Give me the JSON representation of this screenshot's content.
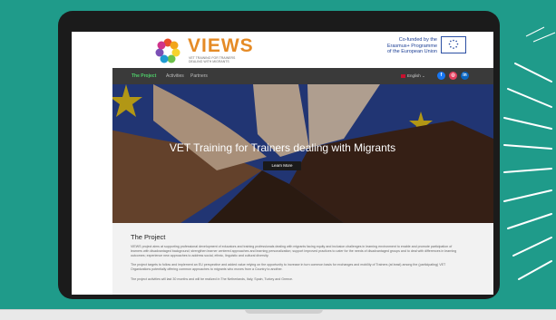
{
  "logo": {
    "name": "VIEWS",
    "tagline": "VET TRAINING FOR TRAINERS DEALING WITH MIGRANTS"
  },
  "cofund": {
    "line1": "Co-funded by the",
    "line2": "Erasmus+ Programme",
    "line3": "of the European Union"
  },
  "nav": {
    "items": [
      {
        "label": "The Project"
      },
      {
        "label": "Activities"
      },
      {
        "label": "Partners"
      }
    ],
    "language": "English",
    "social": {
      "facebook": "f",
      "instagram": "◎",
      "linkedin": "in"
    }
  },
  "hero": {
    "title": "VET Training for Trainers dealing with Migrants",
    "button_label": "Learn More"
  },
  "project": {
    "heading": "The Project",
    "para1": "VIEWS project aims at supporting professional development of educators and training professionals dealing with migrants facing equity and inclusion challenges in learning environment to enable and promote participation of learners with disadvantaged background; strengthen learner centered approaches and learning personalization; support improved practices to cater for the needs of disadvantaged groups and to deal with differences in learning outcomes; experience new approaches to address social, ethnic, linguistic and cultural diversity.",
    "para2": "The project targets to follow and implement an EU perspective and added value relying on the opportunity to increase in turn common basis for exchanges and mobility of Trainers (at least) among the (participating) VET Organizations potentially offering common approaches to migrants who moves from a Country to another.",
    "para3": "The project activities will last 30 months and will be realized in The Netherlands, Italy, Spain, Turkey and Greece."
  },
  "colors": {
    "background": "#1f9b8a",
    "accent_green": "#4fd06a",
    "logo_orange": "#e58b26",
    "eu_blue": "#2f4aa0",
    "eu_star": "#f7d21e"
  }
}
